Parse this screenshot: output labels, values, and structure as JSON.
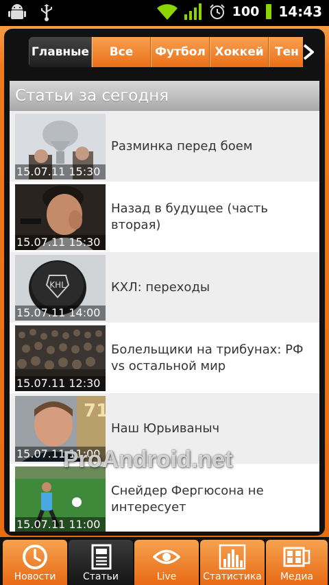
{
  "status_bar": {
    "battery": "100",
    "time": "14:43",
    "icons": [
      "android-debug-icon",
      "usb-icon",
      "wifi-icon",
      "signal-icon",
      "alarm-icon",
      "battery-icon"
    ]
  },
  "tabs": [
    {
      "label": "Главные",
      "active": true
    },
    {
      "label": "Все",
      "active": false
    },
    {
      "label": "Футбол",
      "active": false
    },
    {
      "label": "Хоккей",
      "active": false
    },
    {
      "label": "Тен",
      "active": false
    }
  ],
  "section_title": "Статьи за сегодня",
  "articles": [
    {
      "timestamp": "15.07.11 15:30",
      "title": "Разминка перед боем"
    },
    {
      "timestamp": "15.07.11 15:30",
      "title": "Назад в будущее (часть вторая)"
    },
    {
      "timestamp": "15.07.11 14:00",
      "title": "КХЛ: переходы"
    },
    {
      "timestamp": "15.07.11 12:30",
      "title": "Болельщики на трибунах: РФ vs остальной мир"
    },
    {
      "timestamp": "15.07.11 11:00",
      "title": "Наш Юрьиваныч"
    },
    {
      "timestamp": "15.07.11 11:00",
      "title": "Снейдер Фергюсона не интересует"
    }
  ],
  "watermark": "ProAndroid.net",
  "bottom_nav": [
    {
      "label": "Новости",
      "icon": "clock-icon",
      "active": false
    },
    {
      "label": "Статьи",
      "icon": "document-icon",
      "active": true
    },
    {
      "label": "Live",
      "icon": "eye-icon",
      "active": false
    },
    {
      "label": "Статистика",
      "icon": "bar-chart-icon",
      "active": false
    },
    {
      "label": "Медиа",
      "icon": "film-icon",
      "active": false
    }
  ],
  "colors": {
    "accent": "#ef7a1a",
    "dark": "#111111"
  }
}
